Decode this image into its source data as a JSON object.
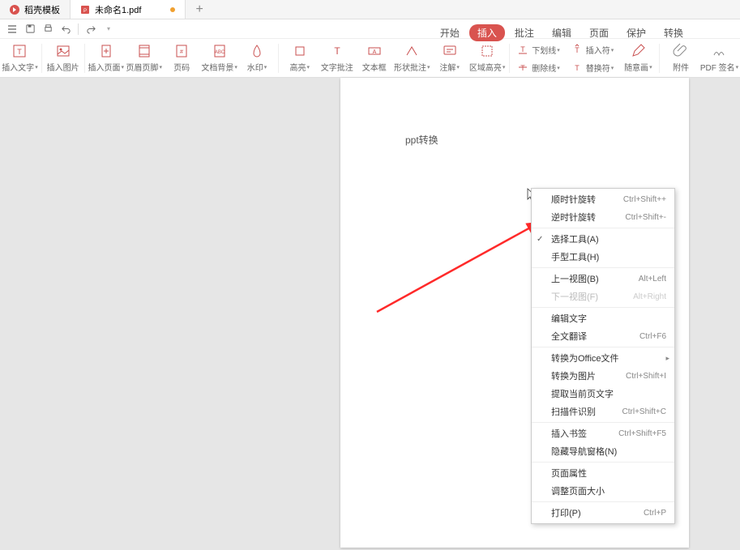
{
  "tabs": [
    {
      "label": "稻壳模板",
      "active": false
    },
    {
      "label": "未命名1.pdf",
      "active": true,
      "modified": true
    }
  ],
  "menubar": {
    "start": "开始",
    "insert": "插入",
    "annotate": "批注",
    "edit": "编辑",
    "page": "页面",
    "protect": "保护",
    "convert": "转换"
  },
  "ribbon": {
    "insert_text": "插入文字",
    "insert_image": "插入图片",
    "insert_page": "插入页面",
    "header_footer": "页眉页脚",
    "page_number": "页码",
    "doc_bg": "文档背景",
    "watermark": "水印",
    "highlight": "高亮",
    "text_annot": "文字批注",
    "textbox": "文本框",
    "shape_annot": "形状批注",
    "comment": "注解",
    "area_hl": "区域高亮",
    "underline": "下划线",
    "strike": "删除线",
    "insert_char": "插入符",
    "replace_char": "替换符",
    "freehand": "随意画",
    "attach": "附件",
    "pdf_sign": "PDF 签名"
  },
  "page_content": "ppt转换",
  "context": {
    "rotate_cw": {
      "label": "顺时针旋转",
      "key": "Ctrl+Shift++"
    },
    "rotate_ccw": {
      "label": "逆时针旋转",
      "key": "Ctrl+Shift+-"
    },
    "select_tool": {
      "label": "选择工具(A)",
      "checked": true
    },
    "hand_tool": {
      "label": "手型工具(H)"
    },
    "prev_view": {
      "label": "上一视图(B)",
      "key": "Alt+Left"
    },
    "next_view": {
      "label": "下一视图(F)",
      "key": "Alt+Right",
      "disabled": true
    },
    "edit_text": {
      "label": "编辑文字"
    },
    "translate": {
      "label": "全文翻译",
      "key": "Ctrl+F6"
    },
    "conv_office": {
      "label": "转换为Office文件",
      "sub": true
    },
    "conv_image": {
      "label": "转换为图片",
      "key": "Ctrl+Shift+I"
    },
    "extract_text": {
      "label": "提取当前页文字"
    },
    "ocr": {
      "label": "扫描件识别",
      "key": "Ctrl+Shift+C"
    },
    "bookmark": {
      "label": "插入书签",
      "key": "Ctrl+Shift+F5"
    },
    "hide_nav": {
      "label": "隐藏导航窗格(N)"
    },
    "page_prop": {
      "label": "页面属性"
    },
    "resize": {
      "label": "调整页面大小"
    },
    "print": {
      "label": "打印(P)",
      "key": "Ctrl+P"
    }
  }
}
